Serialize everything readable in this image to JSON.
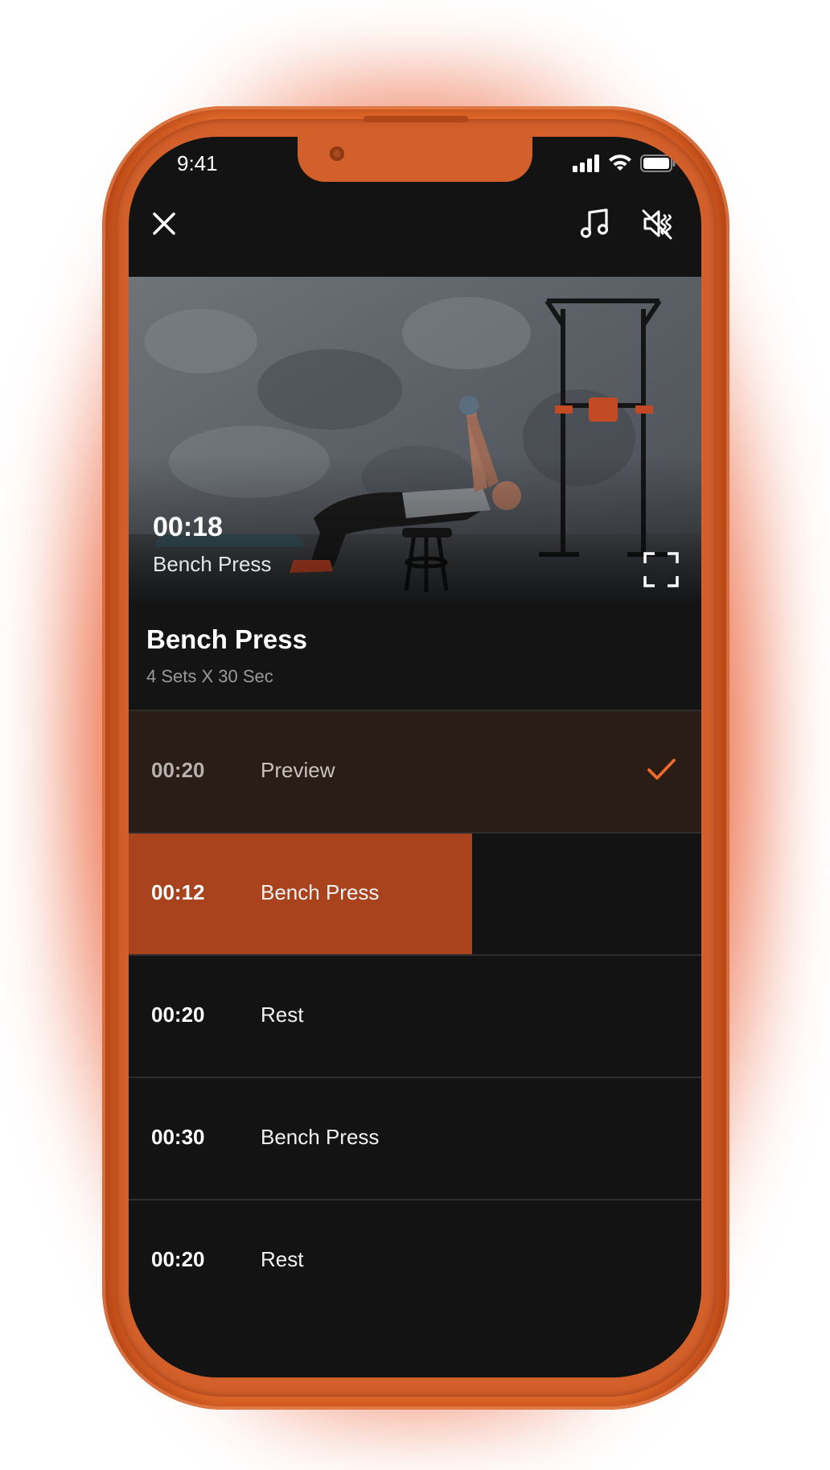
{
  "status_bar": {
    "time": "9:41"
  },
  "toolbar": {
    "close_icon": "close-icon",
    "music_icon": "music-note-icon",
    "mute_icon": "speaker-muted-icon"
  },
  "video": {
    "elapsed": "00:18",
    "exercise_label": "Bench Press",
    "fullscreen_icon": "fullscreen-icon"
  },
  "exercise": {
    "title": "Bench Press",
    "subtitle": "4 Sets X 30 Sec"
  },
  "intervals": [
    {
      "time": "00:20",
      "label": "Preview",
      "state": "done",
      "progress": 1.0
    },
    {
      "time": "00:12",
      "label": "Bench Press",
      "state": "active",
      "progress": 0.6
    },
    {
      "time": "00:20",
      "label": "Rest",
      "state": "upcoming",
      "progress": 0
    },
    {
      "time": "00:30",
      "label": "Bench Press",
      "state": "upcoming",
      "progress": 0
    },
    {
      "time": "00:20",
      "label": "Rest",
      "state": "upcoming",
      "progress": 0
    }
  ],
  "colors": {
    "accent": "#f06a2a",
    "active_fill": "#a8431d",
    "done_row": "#2a1d17",
    "screen_bg": "#131313",
    "phone_body": "#e36a2b"
  }
}
